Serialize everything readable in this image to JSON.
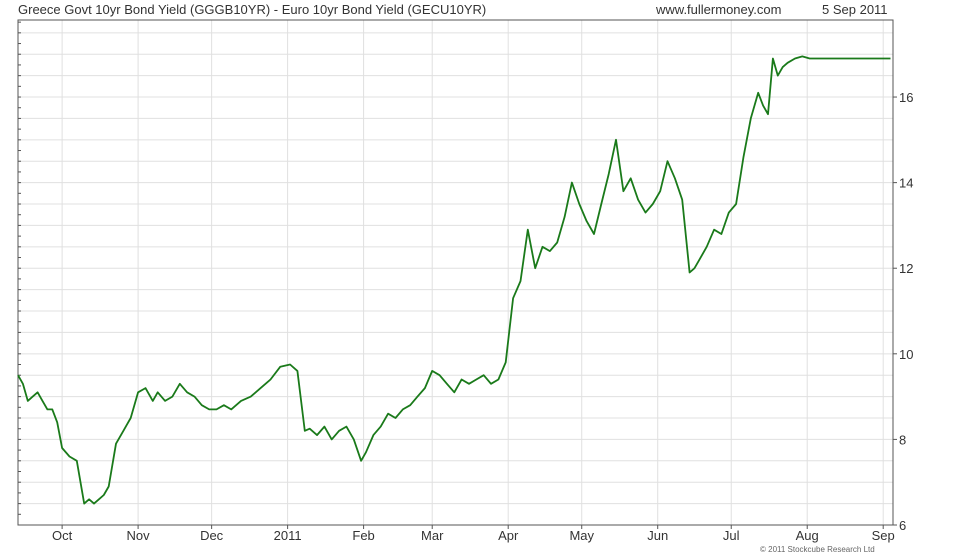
{
  "header": {
    "title": "Greece Govt 10yr Bond Yield (GGGB10YR) - Euro 10yr Bond Yield (GECU10YR)",
    "site": "www.fullermoney.com",
    "date": "5 Sep 2011"
  },
  "footer": {
    "copyright": "© 2011 Stockcube Research Ltd"
  },
  "chart_data": {
    "type": "line",
    "title": "Greece Govt 10yr Bond Yield (GGGB10YR) - Euro 10yr Bond Yield (GECU10YR)",
    "xlabel": "",
    "ylabel": "",
    "x_range": [
      "2010-09-13",
      "2011-09-05"
    ],
    "ylim": [
      6,
      17.8
    ],
    "grid": true,
    "y_axis_side": "right",
    "x_ticks": [
      {
        "date": "2010-10-01",
        "label": "Oct"
      },
      {
        "date": "2010-11-01",
        "label": "Nov"
      },
      {
        "date": "2010-12-01",
        "label": "Dec"
      },
      {
        "date": "2011-01-01",
        "label": "2011"
      },
      {
        "date": "2011-02-01",
        "label": "Feb"
      },
      {
        "date": "2011-03-01",
        "label": "Mar"
      },
      {
        "date": "2011-04-01",
        "label": "Apr"
      },
      {
        "date": "2011-05-01",
        "label": "May"
      },
      {
        "date": "2011-06-01",
        "label": "Jun"
      },
      {
        "date": "2011-07-01",
        "label": "Jul"
      },
      {
        "date": "2011-08-01",
        "label": "Aug"
      },
      {
        "date": "2011-09-01",
        "label": "Sep"
      }
    ],
    "y_ticks": [
      6,
      8,
      10,
      12,
      14,
      16
    ],
    "colors": {
      "line": "#1a7a1a",
      "grid": "#e0e0e0",
      "axis": "#555555"
    },
    "series": [
      {
        "x": [
          "2010-09-13",
          "2010-09-15",
          "2010-09-17",
          "2010-09-19",
          "2010-09-21",
          "2010-09-23",
          "2010-09-25",
          "2010-09-27",
          "2010-09-29",
          "2010-10-01",
          "2010-10-04",
          "2010-10-07",
          "2010-10-10",
          "2010-10-12",
          "2010-10-14",
          "2010-10-16",
          "2010-10-18",
          "2010-10-20",
          "2010-10-23",
          "2010-10-26",
          "2010-10-29",
          "2010-11-01",
          "2010-11-04",
          "2010-11-07",
          "2010-11-09",
          "2010-11-12",
          "2010-11-15",
          "2010-11-18",
          "2010-11-21",
          "2010-11-24",
          "2010-11-27",
          "2010-11-30",
          "2010-12-03",
          "2010-12-06",
          "2010-12-09",
          "2010-12-13",
          "2010-12-17",
          "2010-12-21",
          "2010-12-25",
          "2010-12-29",
          "2011-01-02",
          "2011-01-05",
          "2011-01-08",
          "2011-01-10",
          "2011-01-13",
          "2011-01-16",
          "2011-01-19",
          "2011-01-22",
          "2011-01-25",
          "2011-01-28",
          "2011-01-31",
          "2011-02-02",
          "2011-02-05",
          "2011-02-08",
          "2011-02-11",
          "2011-02-14",
          "2011-02-17",
          "2011-02-20",
          "2011-02-23",
          "2011-02-26",
          "2011-03-01",
          "2011-03-04",
          "2011-03-07",
          "2011-03-10",
          "2011-03-13",
          "2011-03-16",
          "2011-03-19",
          "2011-03-22",
          "2011-03-25",
          "2011-03-28",
          "2011-03-31",
          "2011-04-03",
          "2011-04-06",
          "2011-04-09",
          "2011-04-12",
          "2011-04-15",
          "2011-04-18",
          "2011-04-21",
          "2011-04-24",
          "2011-04-27",
          "2011-04-30",
          "2011-05-03",
          "2011-05-06",
          "2011-05-09",
          "2011-05-12",
          "2011-05-15",
          "2011-05-18",
          "2011-05-21",
          "2011-05-24",
          "2011-05-27",
          "2011-05-30",
          "2011-06-02",
          "2011-06-05",
          "2011-06-08",
          "2011-06-11",
          "2011-06-14",
          "2011-06-16",
          "2011-06-18",
          "2011-06-21",
          "2011-06-24",
          "2011-06-27",
          "2011-06-30",
          "2011-07-03",
          "2011-07-06",
          "2011-07-09",
          "2011-07-12",
          "2011-07-14",
          "2011-07-16",
          "2011-07-18",
          "2011-07-20",
          "2011-07-22",
          "2011-07-24",
          "2011-07-27",
          "2011-07-30",
          "2011-08-02",
          "2011-08-05",
          "2011-08-08",
          "2011-08-11",
          "2011-08-14",
          "2011-08-17",
          "2011-08-20",
          "2011-08-23",
          "2011-08-26",
          "2011-08-29",
          "2011-08-31",
          "2011-09-02",
          "2011-09-04"
        ],
        "y": [
          9.5,
          9.3,
          8.9,
          9.0,
          9.1,
          8.9,
          8.7,
          8.7,
          8.4,
          7.8,
          7.6,
          7.5,
          6.5,
          6.6,
          6.5,
          6.6,
          6.7,
          6.9,
          7.9,
          8.2,
          8.5,
          9.1,
          9.2,
          8.9,
          9.1,
          8.9,
          9.0,
          9.3,
          9.1,
          9.0,
          8.8,
          8.7,
          8.7,
          8.8,
          8.7,
          8.9,
          9.0,
          9.2,
          9.4,
          9.7,
          9.75,
          9.6,
          8.2,
          8.25,
          8.1,
          8.3,
          8.0,
          8.2,
          8.3,
          8.0,
          7.5,
          7.7,
          8.1,
          8.3,
          8.6,
          8.5,
          8.7,
          8.8,
          9.0,
          9.2,
          9.6,
          9.5,
          9.3,
          9.1,
          9.4,
          9.3,
          9.4,
          9.5,
          9.3,
          9.4,
          9.8,
          11.3,
          11.7,
          12.9,
          12.0,
          12.5,
          12.4,
          12.6,
          13.2,
          14.0,
          13.5,
          13.1,
          12.8,
          13.5,
          14.2,
          15.0,
          13.8,
          14.1,
          13.6,
          13.3,
          13.5,
          13.8,
          14.5,
          14.1,
          13.6,
          11.9,
          12.0,
          12.2,
          12.5,
          12.9,
          12.8,
          13.3,
          13.5,
          14.6,
          15.5,
          16.1,
          15.8,
          15.6,
          16.9,
          16.5,
          16.7,
          16.8,
          16.9,
          16.95,
          16.9,
          16.9,
          16.9,
          16.9,
          16.9,
          16.9,
          16.9,
          16.9,
          16.9,
          16.9,
          16.9,
          16.9,
          16.9
        ]
      }
    ]
  }
}
